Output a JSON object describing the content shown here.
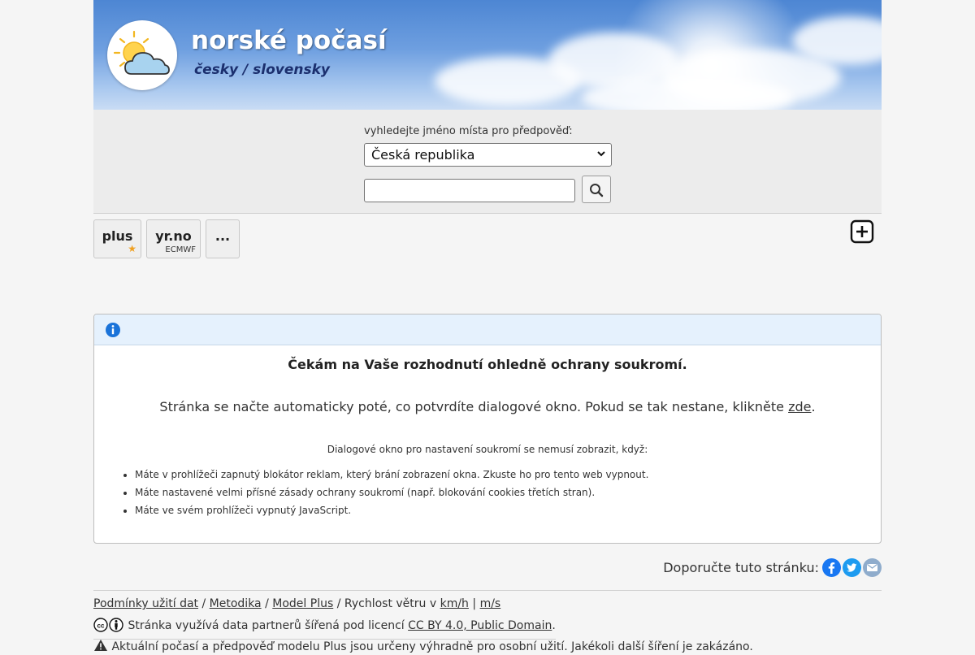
{
  "header": {
    "title": "norské počasí",
    "subtitle": "česky / slovensky",
    "logo_icon": "sun-cloud-icon"
  },
  "search": {
    "label": "vyhledejte jméno místa pro předpověď:",
    "country_selected": "Česká republika",
    "place_value": "",
    "button_icon": "search-icon"
  },
  "tabs": [
    {
      "label": "plus",
      "sub": "",
      "badge": "★"
    },
    {
      "label": "yr.no",
      "sub": "ECMWF"
    },
    {
      "label": "..."
    }
  ],
  "add_icon": "plus-square-icon",
  "info": {
    "icon": "info-icon",
    "title": "Čekám na Vaše rozhodnutí ohledně ochrany soukromí.",
    "text_before": "Stránka se načte automaticky poté, co potvrdíte dialogové okno. Pokud se tak nestane, klikněte ",
    "link": "zde",
    "text_after": ".",
    "sub": "Dialogové okno pro nastavení soukromí se nemusí zobrazit, když:",
    "items": [
      "Máte v prohlížeči zapnutý blokátor reklam, který brání zobrazení okna. Zkuste ho pro tento web vypnout.",
      "Máte nastavené velmi přísné zásady ochrany soukromí (např. blokování cookies třetích stran).",
      "Máte ve svém prohlížeči vypnutý JavaScript."
    ]
  },
  "share": {
    "label": "Doporučte tuto stránku:",
    "icons": [
      "facebook-icon",
      "twitter-icon",
      "email-icon"
    ],
    "colors": {
      "facebook": "#1877f2",
      "twitter": "#1d9bf0",
      "email": "#8faccc"
    }
  },
  "footer": {
    "link_terms": "Podmínky užití dat",
    "sep1": "/",
    "link_method": "Metodika",
    "sep2": "/",
    "link_model": "Model Plus",
    "sep3": "/",
    "wind_label": "Rychlost větru v",
    "link_kmh": "km/h",
    "sep4": "|",
    "link_ms": "m/s",
    "license_text": "Stránka využívá data partnerů šířená pod licencí",
    "license_link": "CC BY 4.0, Public Domain",
    "license_end": ".",
    "warning": "Aktuální počasí a předpověď modelu Plus jsou určeny výhradně pro osobní užití. Jakékoli další šíření je zakázáno."
  }
}
